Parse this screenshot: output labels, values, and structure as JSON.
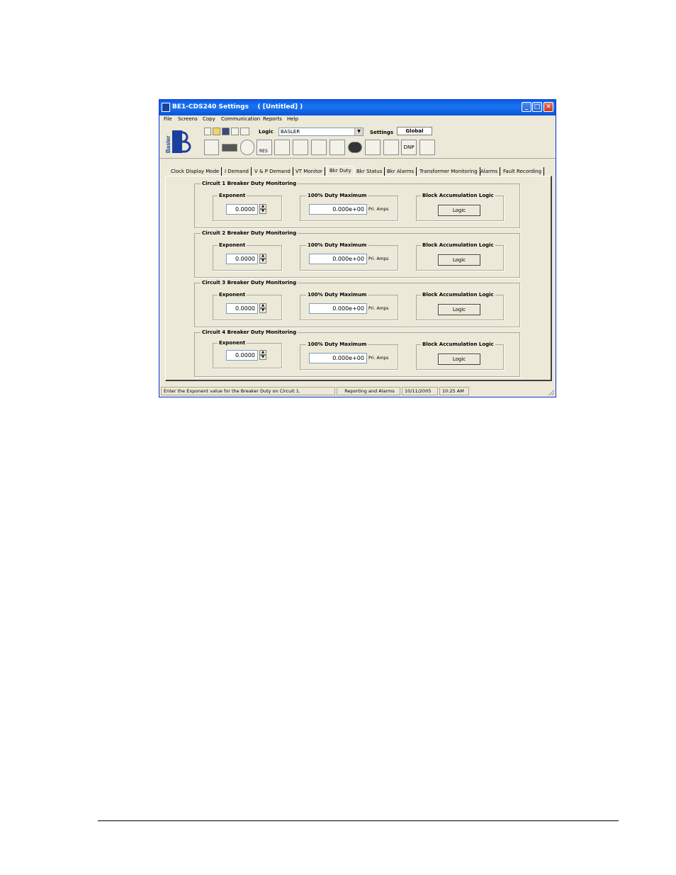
{
  "window": {
    "title": "BE1-CDS240 Settings    ( [Untitled] )",
    "controls": [
      "_",
      "□",
      "✕"
    ]
  },
  "menu": [
    "File",
    "Screens",
    "Copy",
    "Communication",
    "Reports",
    "Help"
  ],
  "toolbar": {
    "logo_text": "Basler",
    "logic_label": "Logic",
    "logic_value": "BASLER",
    "settings_label": "Settings",
    "settings_value": "Global",
    "dnp_label": "DNP",
    "res_label": "RES"
  },
  "tabs": [
    "Clock Display Mode",
    "I Demand",
    "V & P Demand",
    "VT Monitor",
    "Bkr Duty",
    "Bkr Status",
    "Bkr Alarms",
    "Transformer Monitoring",
    "Alarms",
    "Fault Recording"
  ],
  "active_tab": "Bkr Duty",
  "circuits": [
    {
      "title": "Circuit 1 Breaker Duty Monitoring",
      "exponent_label": "Exponent",
      "exponent": "0.0000",
      "duty_label": "100% Duty Maximum",
      "duty": "0.000e+00",
      "units": "Pri. Amps",
      "logic_group": "Block Accumulation Logic",
      "logic_button": "Logic"
    },
    {
      "title": "Circuit 2 Breaker Duty Monitoring",
      "exponent_label": "Exponent",
      "exponent": "0.0000",
      "duty_label": "100% Duty Maximum",
      "duty": "0.000e+00",
      "units": "Pri. Amps",
      "logic_group": "Block Accumulation Logic",
      "logic_button": "Logic"
    },
    {
      "title": "Circuit 3 Breaker Duty Monitoring",
      "exponent_label": "Exponent",
      "exponent": "0.0000",
      "duty_label": "100% Duty Maximum",
      "duty": "0.000e+00",
      "units": "Pri. Amps",
      "logic_group": "Block Accumulation Logic",
      "logic_button": "Logic"
    },
    {
      "title": "Circuit 4 Breaker Duty Monitoring",
      "exponent_label": "Exponent",
      "exponent": "0.0000",
      "duty_label": "100% Duty Maximum",
      "duty": "0.000e+00",
      "units": "Pri. Amps",
      "logic_group": "Block Accumulation Logic",
      "logic_button": "Logic"
    }
  ],
  "status": {
    "message": "Enter the Exponent value for the Breaker Duty on Circuit 1.",
    "mode": "Reporting and Alarms",
    "date": "10/11/2005",
    "time": "10:25 AM"
  }
}
